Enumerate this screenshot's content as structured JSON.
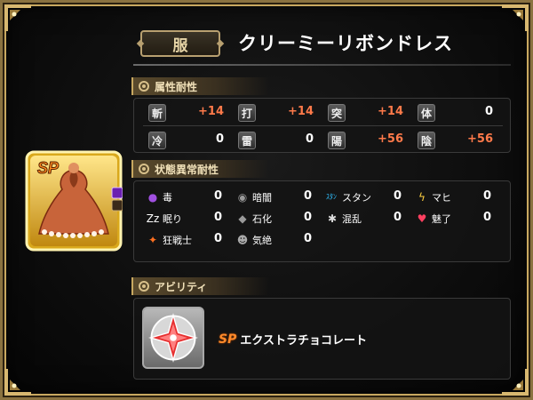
{
  "header": {
    "category": "服",
    "title": "クリーミーリボンドレス"
  },
  "item": {
    "rank_badge": "SP",
    "icon": "creamy-ribbon-dress-icon"
  },
  "attribute_resistance": {
    "section_label": "属性耐性",
    "rows": [
      [
        {
          "icon": "斬",
          "value": "+14",
          "kind": "plus"
        },
        {
          "icon": "打",
          "value": "+14",
          "kind": "plus"
        },
        {
          "icon": "突",
          "value": "+14",
          "kind": "plus"
        },
        {
          "icon": "体",
          "value": "0",
          "kind": "zero"
        }
      ],
      [
        {
          "icon": "冷",
          "value": "0",
          "kind": "zero"
        },
        {
          "icon": "雷",
          "value": "0",
          "kind": "zero"
        },
        {
          "icon": "陽",
          "value": "+56",
          "kind": "plus"
        },
        {
          "icon": "陰",
          "value": "+56",
          "kind": "plus"
        }
      ]
    ]
  },
  "status_resistance": {
    "section_label": "状態異常耐性",
    "rows": [
      [
        {
          "icon": "poison-icon",
          "glyph": "●",
          "color": "#a050e0",
          "label": "毒",
          "value": "0"
        },
        {
          "icon": "darkness-icon",
          "glyph": "◉",
          "color": "#9a9a9a",
          "label": "暗闇",
          "value": "0"
        },
        {
          "icon": "stun-icon",
          "glyph": "ｽﾀﾝ",
          "color": "#30c0ff",
          "label": "スタン",
          "value": "0"
        },
        {
          "icon": "paralysis-icon",
          "glyph": "ϟ",
          "color": "#ffd040",
          "label": "マヒ",
          "value": "0"
        }
      ],
      [
        {
          "icon": "sleep-icon",
          "glyph": "Zz",
          "color": "#ffffff",
          "label": "眠り",
          "value": "0"
        },
        {
          "icon": "petrify-icon",
          "glyph": "◆",
          "color": "#9a9a9a",
          "label": "石化",
          "value": "0"
        },
        {
          "icon": "confusion-icon",
          "glyph": "✱",
          "color": "#dddddd",
          "label": "混乱",
          "value": "0"
        },
        {
          "icon": "charm-icon",
          "glyph": "♥",
          "color": "#ff4060",
          "label": "魅了",
          "value": "0"
        }
      ],
      [
        {
          "icon": "berserk-icon",
          "glyph": "✦",
          "color": "#ff7020",
          "label": "狂戦士",
          "value": "0"
        },
        {
          "icon": "faint-icon",
          "glyph": "☻",
          "color": "#aaaaaa",
          "label": "気絶",
          "value": "0"
        }
      ]
    ]
  },
  "ability": {
    "section_label": "アビリティ",
    "badge": "SP",
    "name": "エクストラチョコレート",
    "icon": "extra-chocolate-ability-icon"
  },
  "colors": {
    "accent_gold": "#c8a860",
    "plus_value": "#ff7a4a"
  }
}
